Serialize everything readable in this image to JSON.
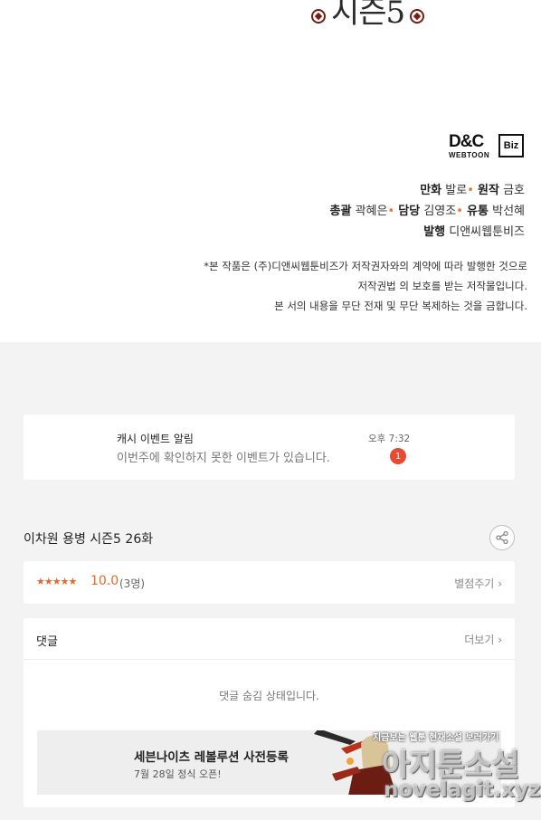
{
  "comic": {
    "season_title": "시즌5",
    "publisher_logo": {
      "main": "D&C",
      "sub": "WEBTOON",
      "badge": "Biz"
    },
    "credits": {
      "line1": {
        "label_a": "만화",
        "value_a": "발로",
        "label_b": "원작",
        "value_b": "금호"
      },
      "line2": {
        "label_a": "총괄",
        "value_a": "곽혜은",
        "label_b": "담당",
        "value_b": "김영조",
        "label_c": "유통",
        "value_c": "박선혜"
      },
      "line3": {
        "label_a": "발행",
        "value_a": "디앤씨웹툰비즈"
      },
      "separator": "•"
    },
    "notice": [
      "*본 작품은 (주)디앤씨웹툰비즈가 저작권자와의 계약에 따라 발행한 것으로",
      "저작권법 의 보호를 받는 저작물입니다.",
      "본 서의 내용을 무단 전재 및 무단 복제하는 것을 금합니다."
    ]
  },
  "notification": {
    "title": "캐시 이벤트 알림",
    "message": "이번주에 확인하지 못한 이벤트가 있습니다.",
    "time": "오후 7:32",
    "badge_count": "1",
    "badge_color": "#e84a2e"
  },
  "episode": {
    "title": "이차원 용병 시즌5 26화",
    "share_icon": "share-icon"
  },
  "rating": {
    "stars": "★★★★★",
    "score": "10.0",
    "votes": "(3명)",
    "rate_button": "별점주기",
    "chevron": "›",
    "accent_color": "#e46a2a"
  },
  "comments": {
    "title": "댓글",
    "more": "더보기",
    "chevron": "›",
    "hidden_message": "댓글 숨김 상태입니다."
  },
  "ad": {
    "title": "세븐나이츠 레볼루션 사전등록",
    "subtitle": "7월 28일 정식 오픈!"
  },
  "watermark": {
    "tagline": "지금보는 웹툰 현재소설 보러가기",
    "brand": "아지툰소설",
    "url": "novelagit.xyz"
  }
}
